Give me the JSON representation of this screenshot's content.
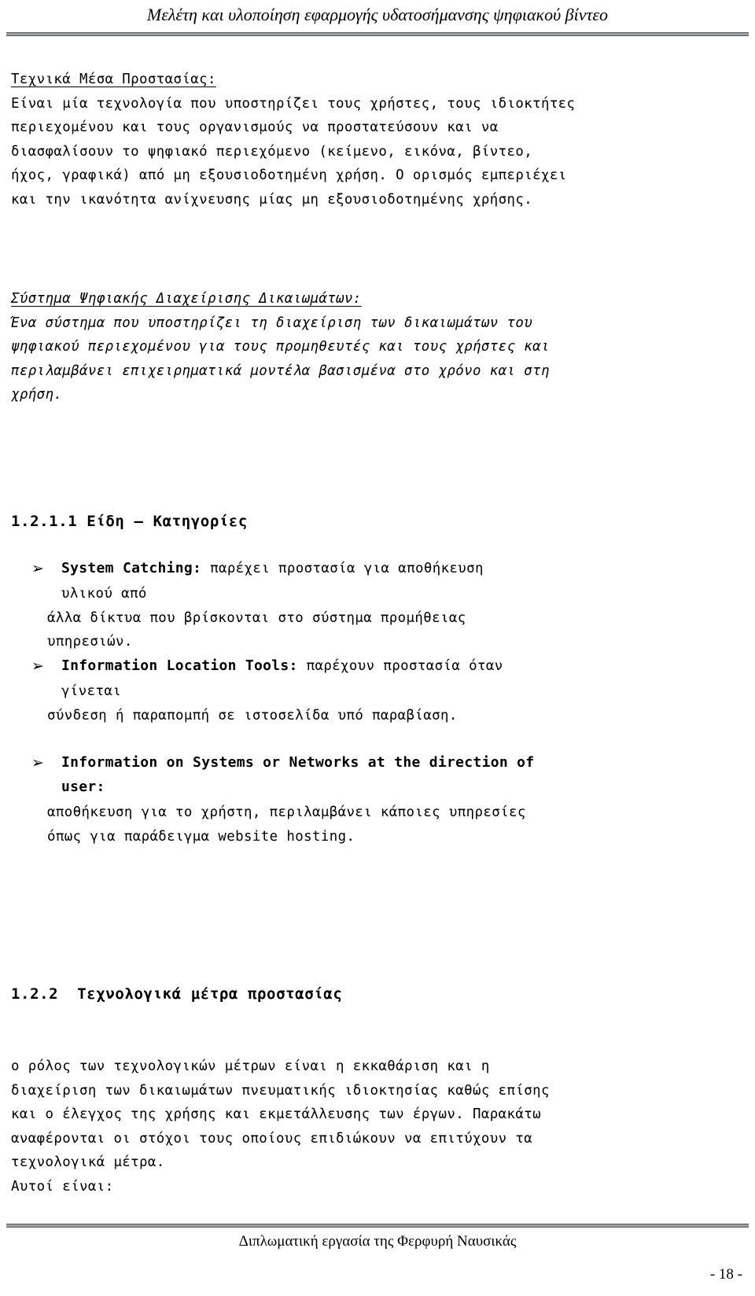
{
  "header": {
    "title": "Μελέτη και υλοποίηση εφαρμογής υδατοσήμανσης ψηφιακού βίντεο"
  },
  "sections": {
    "technical_means": {
      "heading": "Τεχνικά Μέσα Προστασίας:",
      "body": "Είναι μία τεχνολογία που υποστηρίζει τους χρήστες, τους ιδιοκτήτες\nπεριεχομένου και τους οργανισμούς να προστατεύσουν και να\nδιασφαλίσουν το ψηφιακό περιεχόμενο (κείμενο, εικόνα, βίντεο,\nήχος, γραφικά) από μη εξουσιοδοτημένη χρήση. Ο ορισμός εμπεριέχει\nκαι την ικανότητα ανίχνευσης μίας μη εξουσιοδοτημένης χρήσης."
    },
    "drm_system": {
      "heading": "Σύστημα Ψηφιακής Διαχείρισης Δικαιωμάτων:",
      "body": "Ένα σύστημα που υποστηρίζει τη διαχείριση των δικαιωμάτων του\nψηφιακού περιεχομένου για τους προμηθευτές και τους χρήστες και\nπεριλαμβάνει επιχειρηματικά μοντέλα βασισμένα στο χρόνο και στη\nχρήση."
    },
    "types_categories": {
      "number": "1.2.1.1",
      "title": "Είδη – Κατηγορίες",
      "full_heading": "1.2.1.1 Είδη – Κατηγορίες",
      "bullet_glyph": "➢",
      "items": [
        {
          "lead": "System Catching:",
          "body": " παρέχει προστασία για αποθήκευση",
          "lines": [
            "υλικού από",
            "άλλα δίκτυα που βρίσκονται στο σύστημα προμήθειας",
            "υπηρεσιών."
          ]
        },
        {
          "lead": "Information Location Tools:",
          "body": " παρέχουν προστασία όταν",
          "lines": [
            "γίνεται",
            "σύνδεση ή παραπομπή σε ιστοσελίδα υπό παραβίαση."
          ]
        },
        {
          "lead": "Information on Systems or Networks at the direction of\nuser:",
          "body": "",
          "lines": [
            "αποθήκευση για το χρήστη, περιλαμβάνει κάποιες υπηρεσίες",
            "όπως για παράδειγμα website hosting."
          ]
        }
      ]
    },
    "technological_measures": {
      "number": "1.2.2",
      "title": "Τεχνολογικά μέτρα προστασίας",
      "full_heading": "1.2.2  Τεχνολογικά μέτρα προστασίας",
      "body": "ο ρόλος των τεχνολογικών μέτρων είναι η εκκαθάριση και η\nδιαχείριση των δικαιωμάτων πνευματικής ιδιοκτησίας καθώς επίσης\nκαι ο έλεγχος της χρήσης και εκμετάλλευσης των έργων. Παρακάτω\nαναφέρονται οι στόχοι τους οποίους επιδιώκουν να επιτύχουν τα\nτεχνολογικά μέτρα.\nΑυτοί είναι:"
    }
  },
  "footer": {
    "title": "Διπλωματική εργασία της Φερφυρή Ναυσικάς",
    "page_number": "- 18 -"
  },
  "colors": {
    "text": "#000000",
    "rule": "#9aa0a4",
    "background": "#ffffff"
  }
}
